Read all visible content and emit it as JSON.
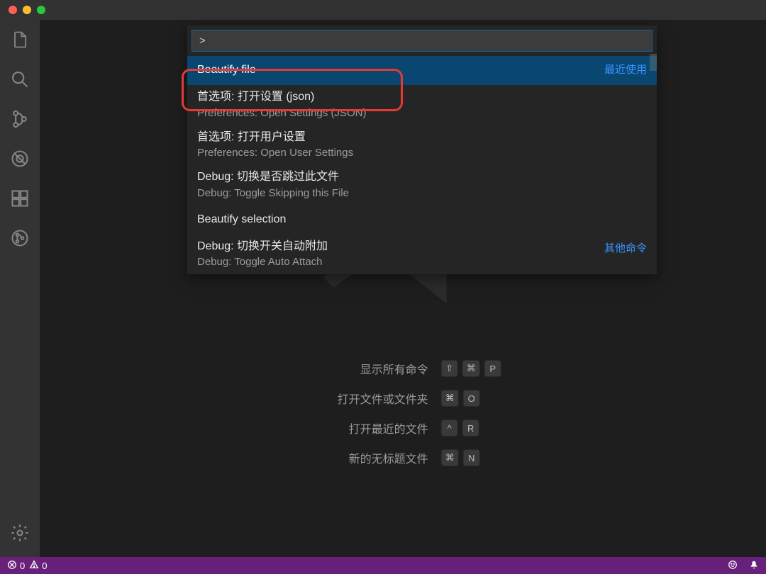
{
  "palette": {
    "input_value": ">",
    "items": [
      {
        "title": "Beautify file",
        "subtitle": "",
        "hint": "最近使用"
      },
      {
        "title": "首选项: 打开设置 (json)",
        "subtitle": "Preferences: Open Settings (JSON)",
        "hint": ""
      },
      {
        "title": "首选项: 打开用户设置",
        "subtitle": "Preferences: Open User Settings",
        "hint": ""
      },
      {
        "title": "Debug: 切换是否跳过此文件",
        "subtitle": "Debug: Toggle Skipping this File",
        "hint": ""
      },
      {
        "title": "Beautify selection",
        "subtitle": "",
        "hint": ""
      },
      {
        "title": "Debug: 切换开关自动附加",
        "subtitle": "Debug: Toggle Auto Attach",
        "hint": "其他命令"
      }
    ]
  },
  "hints": [
    {
      "label": "显示所有命令",
      "keys": [
        "⇧",
        "⌘",
        "P"
      ]
    },
    {
      "label": "打开文件或文件夹",
      "keys": [
        "⌘",
        "O"
      ]
    },
    {
      "label": "打开最近的文件",
      "keys": [
        "^",
        "R"
      ]
    },
    {
      "label": "新的无标题文件",
      "keys": [
        "⌘",
        "N"
      ]
    }
  ],
  "status": {
    "errors": "0",
    "warnings": "0"
  },
  "activity": {
    "explorer": "explorer-icon",
    "search": "search-icon",
    "scm": "source-control-icon",
    "debug": "debug-icon",
    "extensions": "extensions-icon",
    "git": "git-icon",
    "settings": "gear-icon"
  }
}
